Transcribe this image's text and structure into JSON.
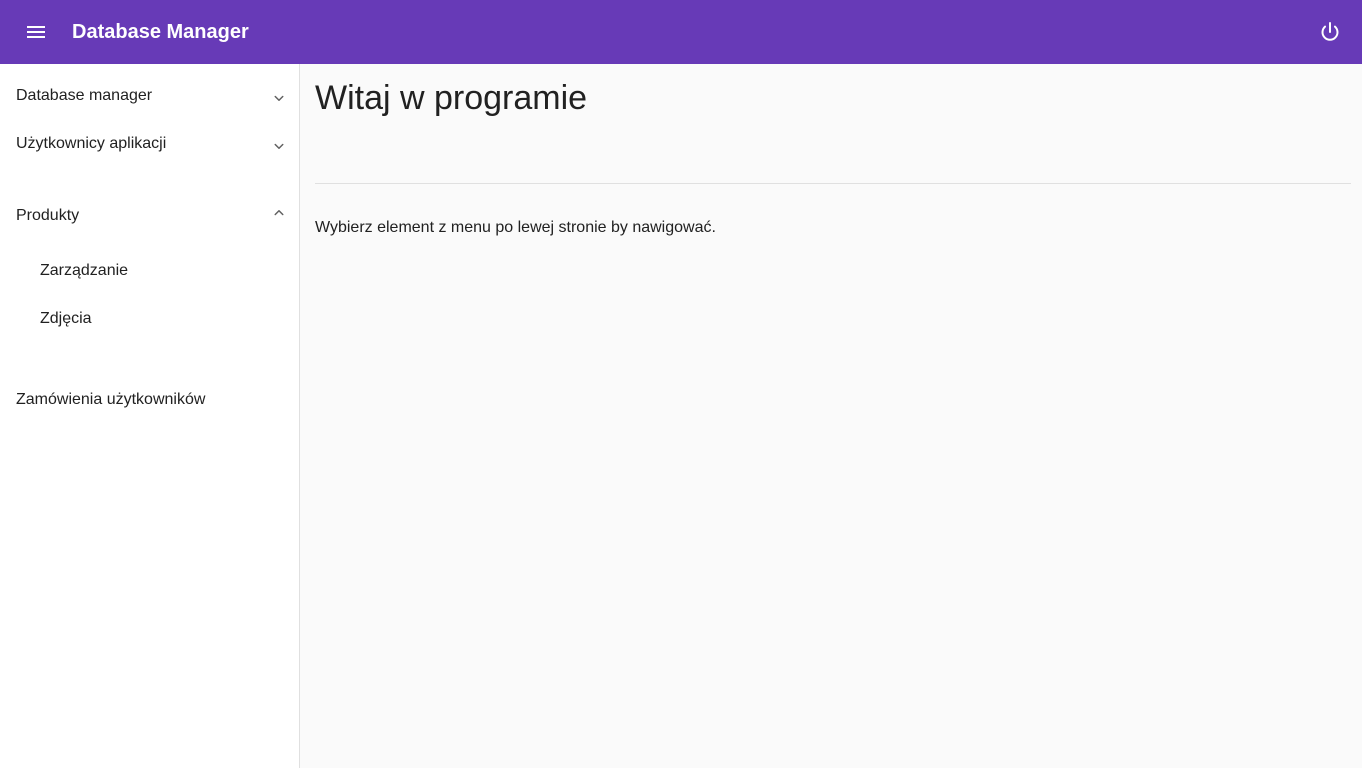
{
  "toolbar": {
    "title": "Database Manager",
    "menu_icon": "menu-icon",
    "power_icon": "power-icon",
    "background": "#673ab7"
  },
  "sidebar": {
    "items": [
      {
        "label": "Database manager",
        "expanded": false
      },
      {
        "label": "Użytkownicy aplikacji",
        "expanded": false
      },
      {
        "label": "Produkty",
        "expanded": true,
        "children": [
          {
            "label": "Zarządzanie"
          },
          {
            "label": "Zdjęcia"
          }
        ]
      },
      {
        "label": "Zamówienia użytkowników"
      }
    ]
  },
  "main": {
    "title": "Witaj w programie",
    "intro": "Wybierz element z menu po lewej stronie by nawigować."
  }
}
